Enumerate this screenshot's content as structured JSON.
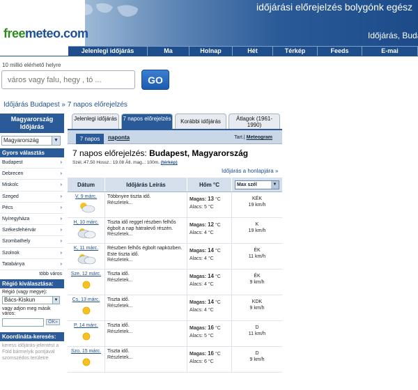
{
  "header": {
    "logo_free": "free",
    "logo_meteo": "meteo.com",
    "tagline": "időjárási előrejelzés bolygónk egész",
    "subline": "Időjárás, Buda"
  },
  "nav": [
    {
      "label": "Jelenlegi időjárás"
    },
    {
      "label": "Ma"
    },
    {
      "label": "Holnap"
    },
    {
      "label": "Hét"
    },
    {
      "label": "Térkép"
    },
    {
      "label": "Feeds"
    },
    {
      "label": "E-mai"
    }
  ],
  "search": {
    "hint": "10 millió elérhető helyre",
    "placeholder": "város vagy falu, hegy , tó ...",
    "go_label": "GO"
  },
  "breadcrumb": {
    "part1": "Időjárás Budapest",
    "sep": " » ",
    "part2": "7 napos előrejelzés"
  },
  "sidebar": {
    "title": "Magyarország Időjárás",
    "country_select": "Magyarország",
    "quick_title": "Gyors választás",
    "cities": [
      "Budapest",
      "Debrecen",
      "Miskolc",
      "Szeged",
      "Pécs",
      "Nyíregyháza",
      "Székesfehérvár",
      "Szombathely",
      "Szolnok",
      "Tatabánya"
    ],
    "more": "több város",
    "region_title": "Régió kiválasztása:",
    "region_label": "Régió (vagy megye):",
    "region_value": "Bács-Kiskun",
    "other_label": "vagy adjon meg másik város:",
    "ok": "OK»",
    "coord_title": "Koordináta-keresés:",
    "coord_text": "keress időjárás-jelentést a Föld bármelyik pontjával szomszédos területre"
  },
  "tabs": [
    {
      "label": "Jelenlegi időjárás"
    },
    {
      "label": "7 napos előrejelzés"
    },
    {
      "label": "Korábbi időjárás"
    },
    {
      "label": "Átlagok (1961-1990)"
    }
  ],
  "subbar": {
    "active": "7 napos",
    "other": "naponta",
    "right_prefix": "Tart.| ",
    "meteogram": "Meteogram"
  },
  "forecast": {
    "title_prefix": "7 napos előrejelzés: ",
    "title_place": "Budapest, Magyarország",
    "coords": "Szél.:47.50 Hossz.: 19.08 Átl. mag..: 100m.",
    "map_link": "(térkép)",
    "back_link": "Időjárás a honlapjára »",
    "headers": {
      "day": "Dátum",
      "desc": "Időjárás Leírás",
      "temp": "Hőm °C",
      "wind": "Max szél"
    },
    "hi_label": "Magas:",
    "lo_label": "Alacs:",
    "unit": "°C",
    "details": "Részletek..."
  },
  "days": [
    {
      "date": "V, 9 márc.",
      "icon": "sun-cloud",
      "desc": "Többnyire tiszta idő.",
      "hi": "13",
      "lo": "5",
      "wind_dir": "KÉK",
      "wind": "19 km/h"
    },
    {
      "date": "H, 10 márc.",
      "icon": "cloudy",
      "desc": "Tiszta idő reggel részben felhős égbolt a nap hátralevő részén.",
      "hi": "12",
      "lo": "4",
      "wind_dir": "K",
      "wind": "19 km/h"
    },
    {
      "date": "K, 11 márc.",
      "icon": "cloudy",
      "desc": "Részben felhős égbolt napközben. Este tiszta idő.",
      "hi": "14",
      "lo": "4",
      "wind_dir": "ÉK",
      "wind": "11 km/h"
    },
    {
      "date": "Sze, 12 márc.",
      "icon": "sun",
      "desc": "Tiszta idő.",
      "hi": "14",
      "lo": "4",
      "wind_dir": "ÉK",
      "wind": "9 km/h"
    },
    {
      "date": "Cs, 13 márc.",
      "icon": "sun",
      "desc": "Tiszta idő.",
      "hi": "14",
      "lo": "4",
      "wind_dir": "KDK",
      "wind": "9 km/h"
    },
    {
      "date": "P, 14 márc.",
      "icon": "sun",
      "desc": "Tiszta idő.",
      "hi": "16",
      "lo": "5",
      "wind_dir": "D",
      "wind": "11 km/h"
    },
    {
      "date": "Szo, 15 márc.",
      "icon": "sun",
      "desc": "Tiszta idő.",
      "hi": "16",
      "lo": "6",
      "wind_dir": "D",
      "wind": "9 km/h"
    }
  ]
}
